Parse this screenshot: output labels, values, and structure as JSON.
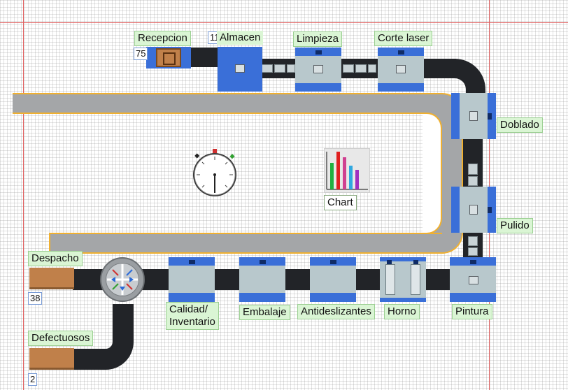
{
  "stations": {
    "recepcion": {
      "label": "Recepcion",
      "count": "75"
    },
    "almacen": {
      "label": "Almacen",
      "count": "11"
    },
    "limpieza": {
      "label": "Limpieza"
    },
    "corte_laser": {
      "label": "Corte laser"
    },
    "doblado": {
      "label": "Doblado"
    },
    "pulido": {
      "label": "Pulido"
    },
    "pintura": {
      "label": "Pintura"
    },
    "horno": {
      "label": "Horno"
    },
    "antideslizantes": {
      "label": "Antideslizantes"
    },
    "embalaje": {
      "label": "Embalaje"
    },
    "calidad": {
      "label_line1": "Calidad/",
      "label_line2": "Inventario"
    },
    "despacho": {
      "label": "Despacho",
      "count": "38"
    },
    "defectuosos": {
      "label": "Defectuosos",
      "count": "2"
    }
  },
  "widgets": {
    "chart_label": "Chart",
    "clock_icon": "stopwatch-icon",
    "chart_icon": "bar-chart-icon"
  },
  "colors": {
    "station_blue": "#3a6fd8",
    "label_bg": "#daf5d4",
    "conveyor": "#222428",
    "road": "#a4a6a8",
    "road_edge": "#f0b030",
    "sink": "#c0804a"
  }
}
